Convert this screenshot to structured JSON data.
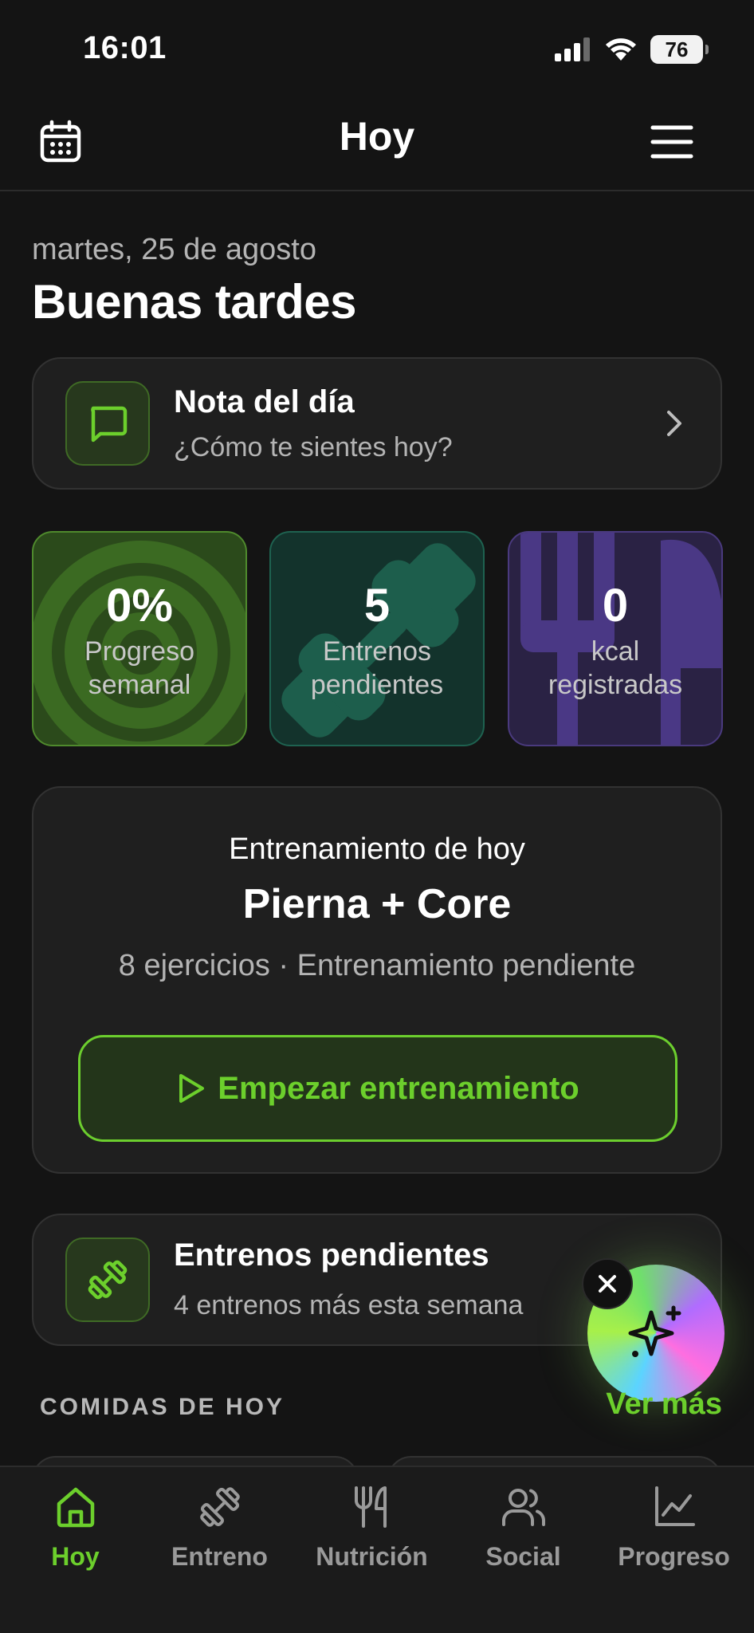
{
  "status_bar": {
    "time": "16:01",
    "battery": "76"
  },
  "header": {
    "title": "Hoy"
  },
  "greeting": {
    "date": "martes, 25 de agosto",
    "text": "Buenas tardes"
  },
  "note_card": {
    "title": "Nota del día",
    "subtitle": "¿Cómo te sientes hoy?"
  },
  "stats": [
    {
      "value": "0%",
      "label_line1": "Progreso",
      "label_line2": "semanal"
    },
    {
      "value": "5",
      "label_line1": "Entrenos",
      "label_line2": "pendientes"
    },
    {
      "value": "0",
      "label_line1": "kcal",
      "label_line2": "registradas"
    }
  ],
  "workout": {
    "heading": "Entrenamiento de hoy",
    "title": "Pierna + Core",
    "meta": "8 ejercicios · Entrenamiento pendiente",
    "button_label": "Empezar entrenamiento"
  },
  "pending": {
    "title": "Entrenos pendientes",
    "subtitle": "4 entrenos más esta semana"
  },
  "meals": {
    "section_title": "COMIDAS DE HOY",
    "see_more": "Ver más"
  },
  "tabs": [
    {
      "label": "Hoy",
      "icon": "home-icon",
      "active": true
    },
    {
      "label": "Entreno",
      "icon": "dumbbell-icon",
      "active": false
    },
    {
      "label": "Nutrición",
      "icon": "utensils-icon",
      "active": false
    },
    {
      "label": "Social",
      "icon": "users-icon",
      "active": false
    },
    {
      "label": "Progreso",
      "icon": "chart-line-icon",
      "active": false
    }
  ],
  "colors": {
    "background": "#141414",
    "card": "#1f1f1f",
    "accent_green": "#6ccf2c",
    "stat_green": "#2b4a1b",
    "stat_teal": "#13332c",
    "stat_purple": "#2a2244",
    "muted_text": "#b4b4b4"
  }
}
